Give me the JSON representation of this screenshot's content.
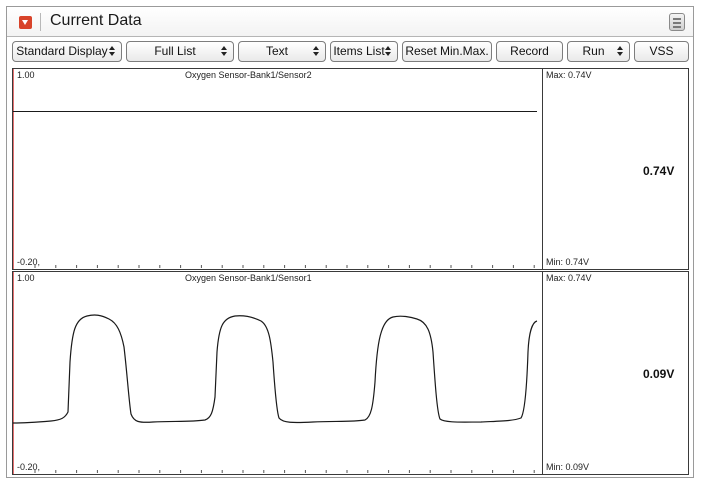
{
  "window": {
    "title": "Current Data",
    "menu_icon": "dropdown-arrow-icon",
    "layout_icon": "list-layout-icon"
  },
  "toolbar": {
    "buttons": [
      {
        "label": "Standard Display",
        "dropdown": true
      },
      {
        "label": "Full List",
        "dropdown": true
      },
      {
        "label": "Text",
        "dropdown": true
      },
      {
        "label": "Items List",
        "dropdown": true
      },
      {
        "label": "Reset Min.Max.",
        "dropdown": false
      },
      {
        "label": "Record",
        "dropdown": false
      },
      {
        "label": "Run",
        "dropdown": true
      },
      {
        "label": "VSS",
        "dropdown": false
      }
    ]
  },
  "graphs": [
    {
      "title": "Oxygen Sensor-Bank1/Sensor2",
      "y_max_label": "1.00",
      "y_min_label": "-0.20,",
      "max_text": "Max: 0.74V",
      "min_text": "Min: 0.74V",
      "current_value": "0.74V"
    },
    {
      "title": "Oxygen Sensor-Bank1/Sensor1",
      "y_max_label": "1.00",
      "y_min_label": "-0.20,",
      "max_text": "Max: 0.74V",
      "min_text": "Min: 0.09V",
      "current_value": "0.09V"
    }
  ],
  "colors": {
    "accent": "#d8432a",
    "trace": "#1a1a1a",
    "left_axis": "#e57070"
  }
}
